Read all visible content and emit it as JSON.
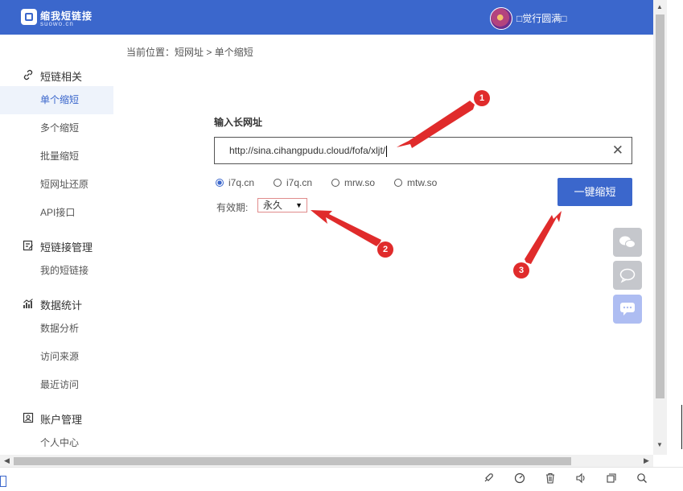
{
  "header": {
    "logo_name": "缩我短链接",
    "logo_sub": "suowo.cn",
    "username": "□觉行圆满□"
  },
  "breadcrumb": {
    "prefix": "当前位置：",
    "parent": "短网址",
    "sep": " > ",
    "current": "单个缩短"
  },
  "sidebar": {
    "groups": [
      {
        "label": "短链相关",
        "icon": "link-icon"
      },
      {
        "label": "短链接管理",
        "icon": "edit-icon"
      },
      {
        "label": "数据统计",
        "icon": "chart-icon"
      },
      {
        "label": "账户管理",
        "icon": "account-icon"
      }
    ],
    "items": [
      {
        "label": "单个缩短"
      },
      {
        "label": "多个缩短"
      },
      {
        "label": "批量缩短"
      },
      {
        "label": "短网址还原"
      },
      {
        "label": "API接口"
      },
      {
        "label": "我的短链接"
      },
      {
        "label": "数据分析"
      },
      {
        "label": "访问来源"
      },
      {
        "label": "最近访问"
      },
      {
        "label": "个人中心"
      }
    ]
  },
  "form": {
    "label": "输入长网址",
    "url_value": "http://sina.cihangpudu.cloud/fofa/xljt/",
    "clear_icon": "close-icon",
    "domains": [
      {
        "label": "i7q.cn",
        "checked": true
      },
      {
        "label": "i7q.cn",
        "checked": false
      },
      {
        "label": "mrw.so",
        "checked": false
      },
      {
        "label": "mtw.so",
        "checked": false
      }
    ],
    "validity_label": "有效期:",
    "validity_value": "永久",
    "shorten_label": "一键缩短"
  },
  "float_buttons": [
    {
      "icon": "wechat-icon",
      "color": "#c5c7cc"
    },
    {
      "icon": "chat-bubble-icon",
      "color": "#c5c7cc"
    },
    {
      "icon": "message-icon",
      "color": "#aebdf2"
    }
  ],
  "annotations": [
    {
      "number": "1"
    },
    {
      "number": "2"
    },
    {
      "number": "3"
    }
  ],
  "colors": {
    "primary": "#3b67cc",
    "annotation": "#e02b2b"
  }
}
